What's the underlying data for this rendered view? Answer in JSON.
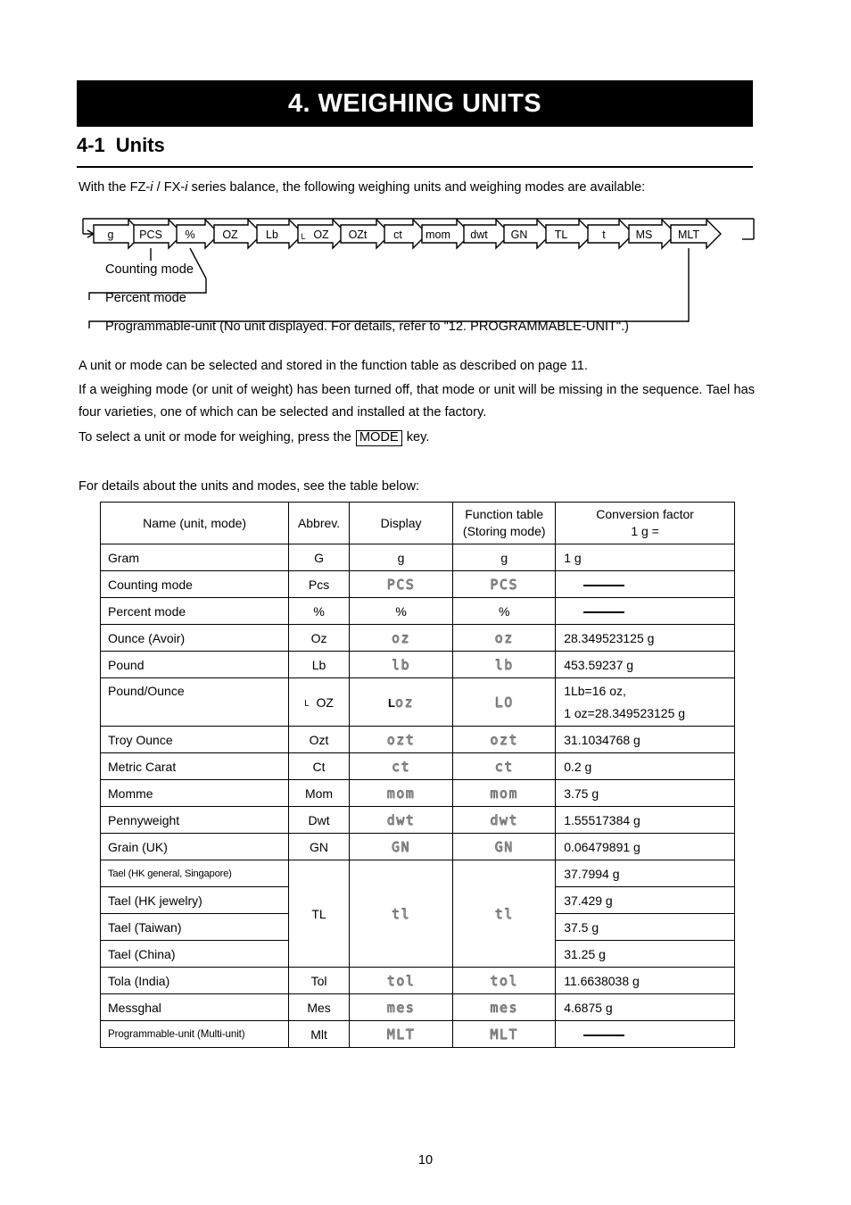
{
  "banner": {
    "title": "4.  WEIGHING UNITS"
  },
  "section": {
    "number": "4-1",
    "title": "Units"
  },
  "paragraphs": {
    "intro_before": "With the FZ-",
    "intro_i1": "i",
    "intro_mid": " / FX-",
    "intro_i2": "i",
    "intro_after": " series balance, the following weighing units and weighing modes are available:",
    "a": "A unit or mode can be selected and stored in the function table as described on page 11.",
    "b": "If a weighing mode (or unit of weight) has been turned off, that mode or unit will be missing in the sequence. Tael has four varieties, one of which can be selected and installed at the factory.",
    "c_before": "To select a unit or mode for weighing, press the ",
    "c_key": "MODE",
    "c_after": " key.",
    "d": "For details about the units and modes, see the table below:"
  },
  "diagram": {
    "units": [
      "g",
      "PCS",
      "%",
      "OZ",
      "Lb",
      "OZ",
      "OZt",
      "ct",
      "mom",
      "dwt",
      "GN",
      "TL",
      "t",
      "MS",
      "MLT"
    ],
    "loz_prefix": "L",
    "labels": {
      "counting": "Counting mode",
      "percent": "Percent mode",
      "programmable": "Programmable-unit (No unit displayed. For details, refer to \"12. PROGRAMMABLE-UNIT\".)"
    }
  },
  "table": {
    "headers": {
      "name": "Name (unit, mode)",
      "abbrev": "Abbrev.",
      "display": "Display",
      "function_table_l1": "Function table",
      "function_table_l2": "(Storing mode)",
      "conversion_l1": "Conversion factor",
      "conversion_l2": "1 g ="
    },
    "rows": [
      {
        "name": "Gram",
        "abbrev": "G",
        "display": "g",
        "func": "g",
        "conv": "1 g"
      },
      {
        "name": "Counting mode",
        "abbrev": "Pcs",
        "display": "PCS",
        "func": "PCS",
        "conv": ""
      },
      {
        "name": "Percent mode",
        "abbrev": "%",
        "display": "%",
        "func": "%",
        "conv": ""
      },
      {
        "name": "Ounce (Avoir)",
        "abbrev": "Oz",
        "display": "oz",
        "func": "oz",
        "conv": "28.349523125 g"
      },
      {
        "name": "Pound",
        "abbrev": "Lb",
        "display": "lb",
        "func": "lb",
        "conv": "453.59237 g"
      },
      {
        "name": "Troy Ounce",
        "abbrev": "Ozt",
        "display": "ozt",
        "func": "ozt",
        "conv": "31.1034768 g"
      },
      {
        "name": "Metric Carat",
        "abbrev": "Ct",
        "display": "ct",
        "func": "ct",
        "conv": "0.2 g"
      },
      {
        "name": "Momme",
        "abbrev": "Mom",
        "display": "mom",
        "func": "mom",
        "conv": "3.75 g"
      },
      {
        "name": "Pennyweight",
        "abbrev": "Dwt",
        "display": "dwt",
        "func": "dwt",
        "conv": "1.55517384 g"
      },
      {
        "name": "Grain (UK)",
        "abbrev": "GN",
        "display": "GN",
        "func": "GN",
        "conv": "0.06479891 g"
      },
      {
        "name": "Tola (India)",
        "abbrev": "Tol",
        "display": "tol",
        "func": "tol",
        "conv": "11.6638038 g"
      },
      {
        "name": "Messghal",
        "abbrev": "Mes",
        "display": "mes",
        "func": "mes",
        "conv": "4.6875 g"
      }
    ],
    "pound_ounce": {
      "name": "Pound/Ounce",
      "abbrev_prefix": "L",
      "abbrev": "OZ",
      "display_prefix": "L",
      "display": "oz",
      "func": "LO",
      "conv_l1": "1Lb=16 oz,",
      "conv_l2": "1 oz=28.349523125 g"
    },
    "tael": {
      "abbrev": "TL",
      "display": "tl",
      "func": "tl",
      "varieties": [
        {
          "name": "Tael (HK general, Singapore)",
          "conv": "37.7994 g"
        },
        {
          "name": "Tael (HK jewelry)",
          "conv": "37.429 g"
        },
        {
          "name": "Tael (Taiwan)",
          "conv": "37.5 g"
        },
        {
          "name": "Tael (China)",
          "conv": "31.25 g"
        }
      ]
    },
    "multi": {
      "name": "Programmable-unit (Multi-unit)",
      "abbrev": "Mlt",
      "display": "MLT",
      "func": "MLT",
      "conv": ""
    }
  },
  "footer": {
    "page": "10"
  }
}
